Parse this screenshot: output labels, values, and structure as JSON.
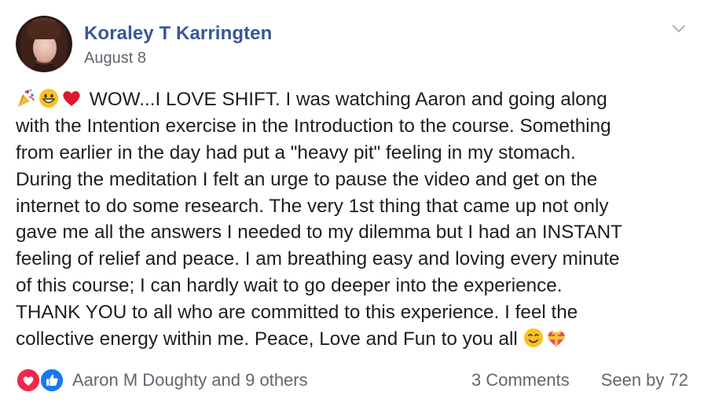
{
  "post": {
    "author": "Koraley T Karringten",
    "date": "August 8",
    "menu_icon": "chevron-down-icon",
    "body_lines": [
      "WOW...I LOVE SHIFT. I was watching Aaron and going along",
      "with the Intention exercise in the Introduction to the course. Something",
      "from earlier in the day had put a \"heavy pit\" feeling in my stomach.",
      "During the meditation I felt an urge to pause the video and get on the",
      "internet to do some research. The very 1st thing that came up not only",
      "gave me all the answers I needed to my dilemma but I had an INSTANT",
      "feeling of relief and peace. I am breathing easy and loving every minute",
      "of this course; I can hardly wait to go deeper into the experience.",
      "THANK YOU to all who are committed to this experience. I feel the",
      "collective energy within me. Peace, Love and Fun to you all"
    ],
    "leading_emojis": [
      "party-popper-icon",
      "grinning-face-icon",
      "red-heart-icon"
    ],
    "trailing_emojis": [
      "smiling-face-icon",
      "heart-with-ribbon-icon"
    ]
  },
  "footer": {
    "reaction_icons": [
      "love-reaction-icon",
      "like-reaction-icon"
    ],
    "reactors": "Aaron M Doughty and 9 others",
    "comments": "3 Comments",
    "seen_by": "Seen by 72"
  },
  "colors": {
    "author_link": "#385898",
    "secondary_text": "#606770",
    "love_red": "#f0284a",
    "like_blue": "#1877f2"
  }
}
